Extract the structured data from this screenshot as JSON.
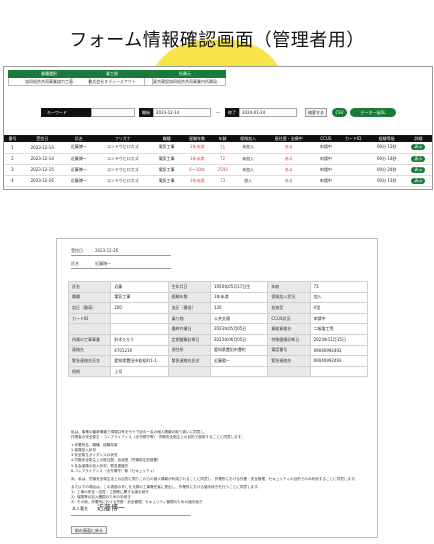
{
  "page_title": "フォーム情報確認画面（管理者用）",
  "colors": {
    "accent_green": "#1a7a3a",
    "banner_yellow": "#f7e34a",
    "alert_red": "#d63b3b"
  },
  "categories": [
    {
      "head": "業種選択",
      "sub": "協同組合共同事業協力工事"
    },
    {
      "head": "業工務",
      "sub": "株式会社オディーズアウト"
    },
    {
      "head": "所属元",
      "sub": "東京建設協同組合共同事業内所属局"
    }
  ],
  "filter": {
    "keyword_label": "キーワード",
    "start_label": "開始",
    "start_value": "2023-12-14",
    "end_label": "終了",
    "end_value": "2024-01-24",
    "dash": "～",
    "search_button": "検索する",
    "csv_button": "CSV",
    "download_button": "データ一括DL"
  },
  "table": {
    "headers": [
      "番号",
      "受信日",
      "氏名",
      "フリガナ",
      "職種",
      "経験年数",
      "年齢",
      "保険加入",
      "既往歴・治療中",
      "CCUS",
      "カードID",
      "経験等級",
      "詳細"
    ],
    "rows": [
      {
        "no": "1",
        "date": "2023-12-14",
        "name": "近藤博一",
        "kana": "コンドウヒロカズ",
        "job": "電気工事",
        "exp": "1年未満",
        "age": "71",
        "ins": "未加入",
        "history": "ある",
        "ccus": "申請中",
        "card": "",
        "grade": "00分 13秒",
        "btn": "表示"
      },
      {
        "no": "2",
        "date": "2023-12-14",
        "name": "近藤博一",
        "kana": "コンドウヒロカズ",
        "job": "電気工事",
        "exp": "1年未満",
        "age": "72",
        "ins": "未加入",
        "history": "ある",
        "ccus": "申請中",
        "card": "",
        "grade": "00分 14秒",
        "btn": "表示"
      },
      {
        "no": "3",
        "date": "2023-12-15",
        "name": "近藤博一",
        "kana": "コンドウヒロカズ",
        "job": "電気工事",
        "exp": "6～10年",
        "age": "2593",
        "ins": "未加入",
        "history": "ある",
        "ccus": "申請中",
        "card": "",
        "grade": "00分 24秒",
        "btn": "表示"
      },
      {
        "no": "4",
        "date": "2023-12-26",
        "name": "近藤博一",
        "kana": "コンドウヒロカズ",
        "job": "電気工事",
        "exp": "1年未満",
        "age": "73",
        "ins": "加入",
        "history": "ある",
        "ccus": "申請中",
        "card": "",
        "grade": "00分 13秒",
        "btn": "表示"
      }
    ]
  },
  "detail": {
    "received_label": "受信日",
    "received_value": "2023-12-26",
    "name_label": "氏名",
    "name_value": "近藤博一",
    "rows": [
      [
        "氏名",
        "近藤",
        "生年月日",
        "1950年05月17日生",
        "年齢",
        "73"
      ],
      [
        "職種",
        "電気工事",
        "経験年数",
        "1年未満",
        "保険加入状況",
        "加入"
      ],
      [
        "血圧（最高）",
        "200",
        "血圧（最低）",
        "120",
        "血液型",
        "A型"
      ],
      [
        "カードID",
        "",
        "乗り物",
        "公共交通",
        "CCUS状況",
        "申請中"
      ],
      [
        "",
        "",
        "最終作業日",
        "2023年05月05日",
        "業務資格名",
        "二級電工等"
      ],
      [
        "所属の工事事業",
        "鈴木たろう",
        "定期健康診断日",
        "2023年06月05日",
        "特殊健康診断日",
        "2023年11月15日"
      ],
      [
        "連絡先",
        "4701219",
        "現住所",
        "愛知県豊田市豊町",
        "電話番号",
        "09040992492"
      ],
      [
        "緊急連絡先氏名",
        "愛知県豊田市若松町1-1",
        "緊急連絡先氏名",
        "近藤陽一",
        "緊急連絡先",
        "09040992492"
      ],
      [
        "続柄",
        "上司",
        "",
        "",
        "",
        ""
      ]
    ]
  },
  "consent": {
    "lines": [
      "私は、事業の最新情報で現場共有を行う下記の一名の個人情報の取り扱いに同意し、",
      "作業者の安全衛生・コンプライアンス（法令順守等）・労働安全衛生上の目的で使用することに同意します。",
      "",
      "1.作業所名、職種、経験年数",
      "2.保険加入状況",
      "3.安全衛生ガイダンスの状況",
      "4.労働安全衛生上の既往歴、血液型（労働衛生的措置）",
      "5.社会保険の加入状況、緊急連絡先",
      "6.コンプライアンス（法令順守）等（セキュリティ）",
      "",
      "尚、私は、労働安全衛生法上の目的に限りこれらの個人情報が利用されることに同意し、作業所における作業・安全管理、セキュリティの目的でのみ利用することに同意します。",
      "",
      "また以下の場合は、この書面の写しを元請の工事責任者に提出し、作業所における諸手続きを行うことに同意します。",
      "1）工事の安全・品質・工期等に関する諸手続き",
      "2）保険等の加入確認のための手続き",
      "3）その他、作業所における労務・安全管理、セキュリティ管理のための諸手続き"
    ]
  },
  "signature": {
    "label": "本人署名",
    "name": "近藤博一"
  },
  "back_button": "前の画面に戻る"
}
